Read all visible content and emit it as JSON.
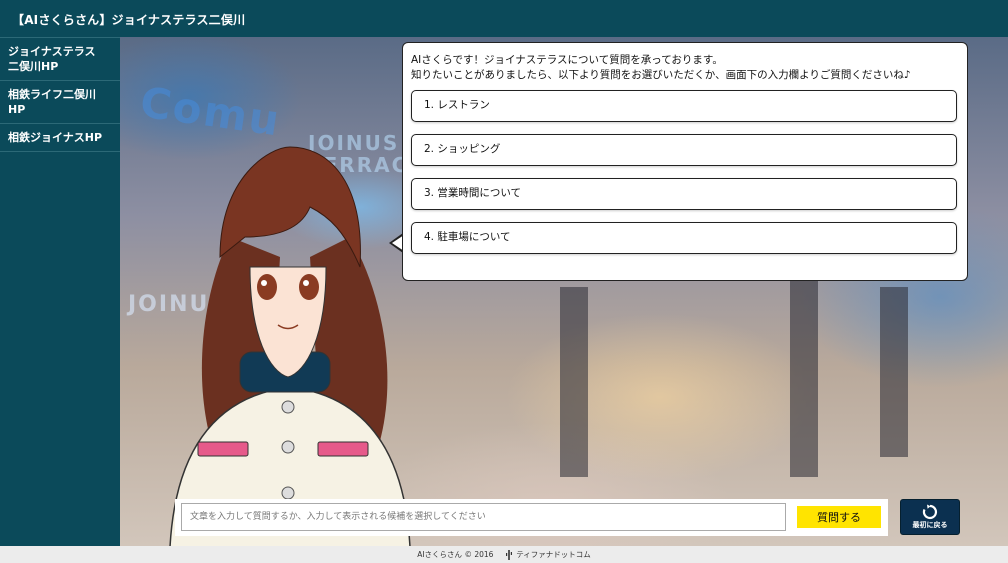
{
  "header": {
    "title": "【AIさくらさん】ジョイナステラス二俣川"
  },
  "sidebar": {
    "items": [
      {
        "label_line1": "ジョイナステラス",
        "label_line2": "二俣川HP"
      },
      {
        "label_line1": "相鉄ライフ二俣川HP"
      },
      {
        "label_line1": "相鉄ジョイナスHP"
      }
    ]
  },
  "background": {
    "sign_1": "Comu",
    "sign_2_line1": "JOINUS",
    "sign_2_line2": "TERRACE",
    "sign_3": "JOINUS"
  },
  "bubble": {
    "line1": "AIさくらです！ジョイナステラスについて質問を承っております。",
    "line2": "知りたいことがありましたら、以下より質問をお選びいただくか、画面下の入力欄よりご質問くださいね♪",
    "choices": [
      "1. レストラン",
      "2. ショッピング",
      "3. 営業時間について",
      "4. 駐車場について"
    ]
  },
  "input": {
    "placeholder": "文章を入力して質問するか、入力して表示される候補を選択してください",
    "value": "",
    "submit_label": "質問する"
  },
  "reset": {
    "label": "最初に戻る",
    "icon": "refresh-icon"
  },
  "footer": {
    "copyright": "AIさくらさん © 2016",
    "company": "ティファナドットコム",
    "icon": "cactus-icon"
  },
  "colors": {
    "primary": "#0b4a5a",
    "accent": "#ffe400",
    "reset_bg": "#0b3050"
  }
}
